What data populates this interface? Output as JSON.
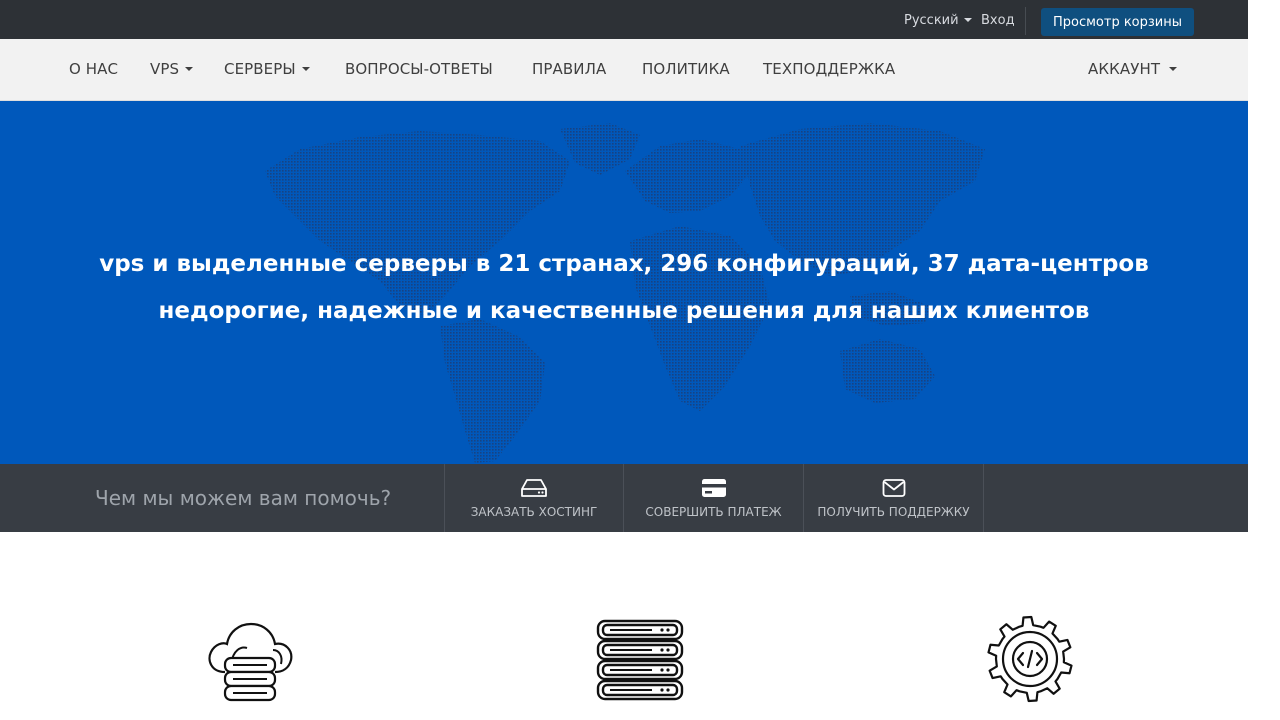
{
  "topbar": {
    "language": "Русский",
    "login": "Вход",
    "cart_button": "Просмотр корзины"
  },
  "nav": {
    "items": [
      {
        "label": "О НАС"
      },
      {
        "label": "VPS"
      },
      {
        "label": "СЕРВЕРЫ"
      },
      {
        "label": "ВОПРОСЫ-ОТВЕТЫ"
      },
      {
        "label": "ПРАВИЛА"
      },
      {
        "label": "ПОЛИТИКА"
      },
      {
        "label": "ТЕХПОДДЕРЖКА"
      }
    ],
    "account": "АККАУНТ"
  },
  "hero": {
    "line1": "vps и выделенные серверы в 21 странах, 296 конфигураций, 37 дата-центров",
    "line2": "недорогие, надежные и качественные решения для наших клиентов"
  },
  "help": {
    "prompt": "Чем мы можем вам помочь?",
    "actions": [
      {
        "label": "ЗАКАЗАТЬ ХОСТИНГ",
        "icon": "hard-drive-icon"
      },
      {
        "label": "СОВЕРШИТЬ ПЛАТЕЖ",
        "icon": "credit-card-icon"
      },
      {
        "label": "ПОЛУЧИТЬ ПОДДЕРЖКУ",
        "icon": "envelope-icon"
      }
    ]
  },
  "features": [
    {
      "icon": "cloud-server-icon"
    },
    {
      "icon": "server-rack-icon"
    },
    {
      "icon": "gear-code-icon"
    }
  ],
  "colors": {
    "topbar": "#2d3136",
    "nav_background": "#f2f2f2",
    "hero": "#0058bb",
    "helpbar": "#383d44",
    "cart_button": "#0f4f7f"
  }
}
